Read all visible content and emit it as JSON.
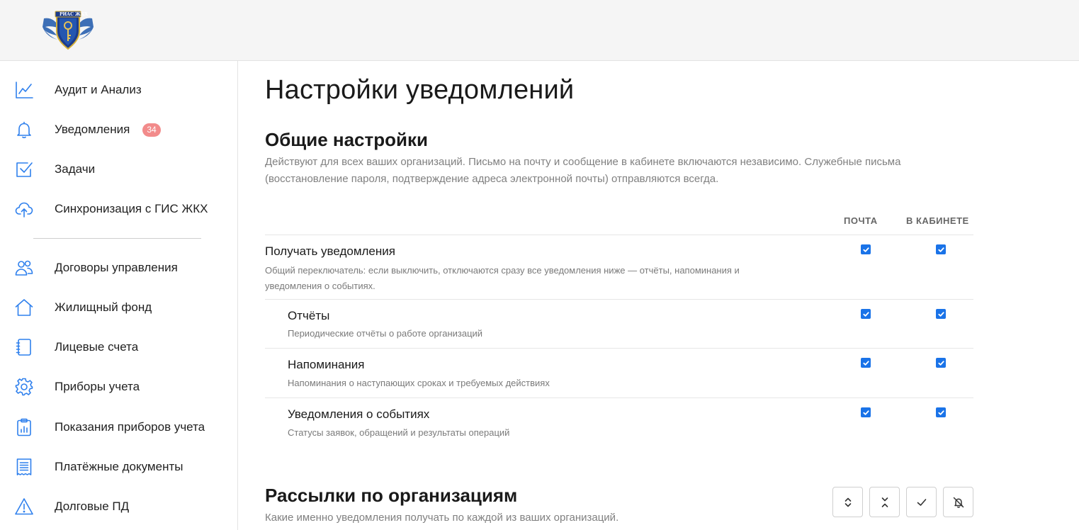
{
  "header": {
    "logo_text": "РИАС ЖКХ"
  },
  "sidebar": {
    "items": [
      {
        "label": "Аудит и Анализ",
        "icon": "chart-line-icon"
      },
      {
        "label": "Уведомления",
        "icon": "bell-icon",
        "badge": "34"
      },
      {
        "label": "Задачи",
        "icon": "checkbox-icon"
      },
      {
        "label": "Синхронизация с ГИС ЖКХ",
        "icon": "cloud-upload-icon"
      },
      {
        "label": "Договоры управления",
        "icon": "users-icon"
      },
      {
        "label": "Жилищный фонд",
        "icon": "house-icon"
      },
      {
        "label": "Лицевые счета",
        "icon": "notebook-icon"
      },
      {
        "label": "Приборы учета",
        "icon": "gear-icon"
      },
      {
        "label": "Показания приборов учета",
        "icon": "clipboard-chart-icon"
      },
      {
        "label": "Платёжные документы",
        "icon": "receipt-icon"
      },
      {
        "label": "Долговые ПД",
        "icon": "warning-icon"
      }
    ]
  },
  "main": {
    "title": "Настройки уведомлений",
    "general": {
      "title": "Общие настройки",
      "description": "Действуют для всех ваших организаций. Письмо на почту и сообщение в кабинете включаются независимо. Служебные письма (восстановление пароля, подтверждение адреса электронной почты) отправляются всегда.",
      "columns": {
        "email": "ПОЧТА",
        "cabinet": "В КАБИНЕТЕ"
      },
      "rows": [
        {
          "title": "Получать уведомления",
          "description": "Общий переключатель: если выключить, отключаются сразу все уведомления ниже — отчёты, напоминания и уведомления о событиях.",
          "email": true,
          "cabinet": true
        },
        {
          "title": "Отчёты",
          "description": "Периодические отчёты о работе организаций",
          "email": true,
          "cabinet": true
        },
        {
          "title": "Напоминания",
          "description": "Напоминания о наступающих сроках и требуемых действиях",
          "email": true,
          "cabinet": true
        },
        {
          "title": "Уведомления о событиях",
          "description": "Статусы заявок, обращений и результаты операций",
          "email": true,
          "cabinet": true
        }
      ]
    },
    "mailings": {
      "title": "Рассылки по организациям",
      "description": "Какие именно уведомления получать по каждой из ваших организаций.",
      "tools": [
        {
          "icon": "expand-icon"
        },
        {
          "icon": "collapse-icon"
        },
        {
          "icon": "check-icon"
        },
        {
          "icon": "bell-off-icon"
        }
      ]
    }
  },
  "colors": {
    "accent": "#1a73e8",
    "icon_blue": "#2f80ed",
    "badge": "#f28b8b"
  }
}
